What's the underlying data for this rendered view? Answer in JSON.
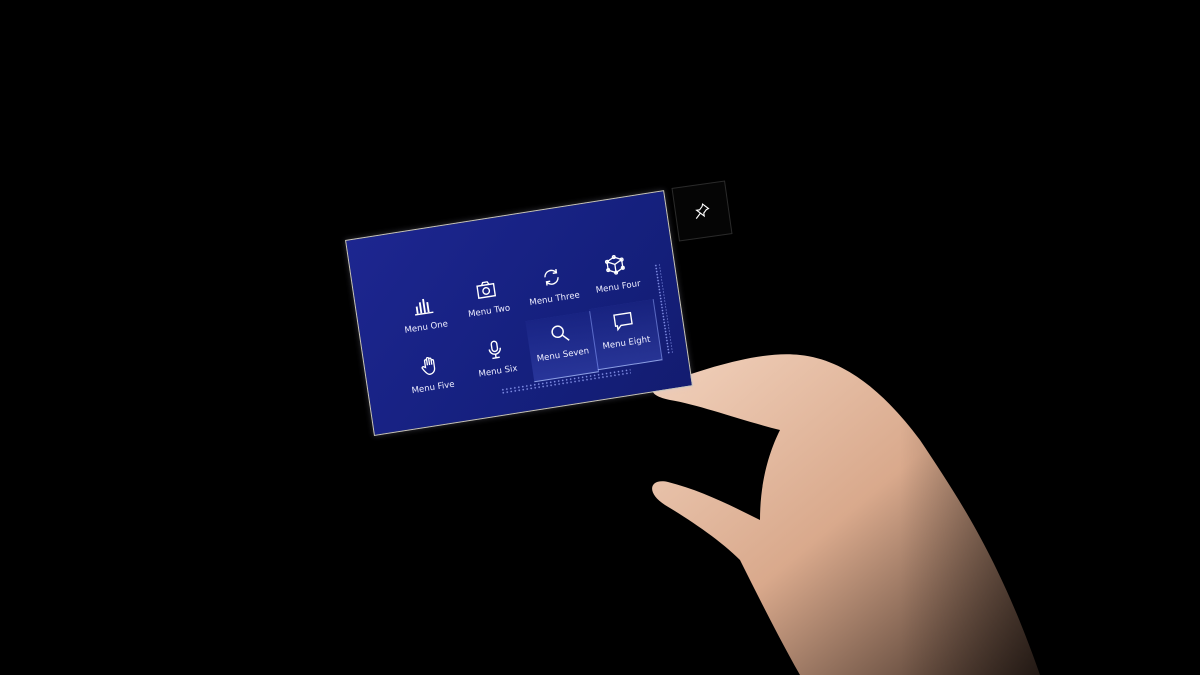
{
  "menu": {
    "items": [
      {
        "label": "Menu One",
        "icon": "bar-chart-icon"
      },
      {
        "label": "Menu Two",
        "icon": "camera-icon"
      },
      {
        "label": "Menu Three",
        "icon": "refresh-icon"
      },
      {
        "label": "Menu Four",
        "icon": "cube-icon"
      },
      {
        "label": "Menu Five",
        "icon": "hand-icon"
      },
      {
        "label": "Menu Six",
        "icon": "microphone-icon"
      },
      {
        "label": "Menu Seven",
        "icon": "search-icon"
      },
      {
        "label": "Menu Eight",
        "icon": "chat-bubble-icon"
      }
    ]
  },
  "pin_button": {
    "icon": "pin-icon"
  },
  "colors": {
    "panel": "#18227f",
    "border": "#c9c6bd",
    "skin": "#e8bfa5"
  }
}
